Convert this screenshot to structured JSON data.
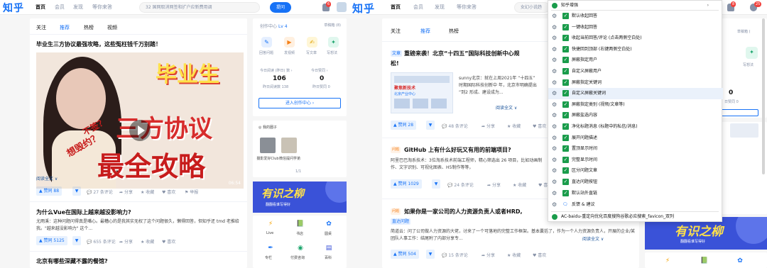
{
  "left": {
    "logo": "知乎",
    "nav": [
      "首页",
      "会员",
      "发现",
      "等你来答"
    ],
    "search_placeholder": "32 国网取消网签和扩户应新费用调",
    "ask_button": "提问",
    "notif_count": "6",
    "tabs": [
      "关注",
      "推荐",
      "热榜",
      "视频"
    ],
    "q1": {
      "title": "毕业生三方协议最强攻略，这些冤枉钱千万别踏！",
      "cover_line1": "毕业生",
      "cover_line2": "三方协议",
      "cover_line3": "最全攻略",
      "cover_tag1": "不签？",
      "cover_tag2": "想毁约？",
      "duration": "06:54",
      "read_more": "阅读全文 ∨",
      "vote": "▲ 赞同 88",
      "comments": "27 条评论",
      "share": "分享",
      "fav": "收藏",
      "like": "喜欢",
      "report": "举报"
    },
    "q2": {
      "title": "为什么Vue在国际上越来越没影响力?",
      "excerpt": "尤雨溪：这种问题问得真是嘴心。最糟心的是我其实无权了这个问题很久，懒得回答，但知乎还 tmd 老推给我。\"越来越没影响力\" 这个...",
      "read_more": "阅读全文 ∨",
      "vote": "▲ 赞同 5125",
      "comments": "655 条评论",
      "share": "分享",
      "fav": "收藏",
      "like": "喜欢"
    },
    "q3": {
      "title": "北京有哪些深藏不露的餐馆?"
    },
    "side": {
      "creator": "创作中心",
      "level": "Lv 4",
      "drafts": "草稿箱 (8)",
      "tools": [
        {
          "label": "回答问题",
          "icon": "answer-icon"
        },
        {
          "label": "发视频",
          "icon": "video-icon"
        },
        {
          "label": "写文章",
          "icon": "article-icon"
        },
        {
          "label": "写想法",
          "icon": "idea-icon"
        }
      ],
      "stat1_label": "今日阅读 (昨日) 数 ›",
      "stat1_value": "106",
      "stat1_sub": "昨日阅读数 138",
      "stat2_label": "今日赞同 ›",
      "stat2_value": "0",
      "stat2_sub": "昨日赞同 0",
      "enter_creator": "进入创作中心 ›",
      "my_circles": "我的圈子",
      "circles": [
        {
          "name": "摄影爱好Club"
        },
        {
          "name": "微信提问学弟"
        }
      ],
      "pager": "1/1",
      "banner_title": "有识之柳",
      "banner_sub": "翻翻看谁写得好",
      "quick": [
        {
          "label": "Live",
          "icon": "live-icon"
        },
        {
          "label": "书店",
          "icon": "book-icon"
        },
        {
          "label": "圆桌",
          "icon": "roundtable-icon"
        },
        {
          "label": "专栏",
          "icon": "column-icon"
        },
        {
          "label": "付费咨询",
          "icon": "consult-icon"
        },
        {
          "label": "百科",
          "icon": "wiki-icon"
        }
      ]
    }
  },
  "right": {
    "logo": "知乎",
    "nav": [
      "首页",
      "会员",
      "发现",
      "等你来答"
    ],
    "search_placeholder": "女幻小说趋",
    "notif_count": "8",
    "msg_count": "25",
    "tabs": [
      "关注",
      "推荐",
      "热榜"
    ],
    "q1": {
      "tag": "文章",
      "title": "重磅来袭！北京“十四五”国际科技创新中心规",
      "title2": "松!",
      "thumb_line1": "聚焦新技术",
      "thumb_line2": "北京产业中心",
      "excerpt": "sunny北京：就在上周2021年 “十四五” 时期国际科技创新中 年，北京市明确提出 “到2 形成、建设成为...",
      "read_more": "阅读全文 ∨",
      "vote": "▲ 赞同 28",
      "comments": "48 条评论",
      "share": "分享",
      "fav": "收藏",
      "like": "喜欢"
    },
    "q2": {
      "tag": "问题",
      "title": "GitHub 上有什么好玩又有用的前端项目?",
      "excerpt": "阿里巴巴淘系技术：3位淘系技术前端工程师，精心筛选出 26 项目，比如动画制作、文字识别、可视化图表、H5制作等等，",
      "vote": "▲ 赞同 1029",
      "comments": "24 条评论",
      "share": "分享",
      "fav": "收藏",
      "like": "喜欢"
    },
    "q3": {
      "tag": "问题",
      "title": "如果你是一家公司的人力资源负责人或者HRD,",
      "answer_tag": "直达问题",
      "excerpt": "简道云：问了公司做人力资源的大佬，讨来了一个可落地的完整工作框架。基本囊括了，作为一个人力资源负责人，开展的企业/某团队人事工作：结尾附了内部分享专...",
      "read_more": "阅读全文 ∨",
      "vote": "▲ 赞同 504",
      "comments": "15 条评论",
      "share": "分享",
      "fav": "收藏",
      "like": "喜欢"
    },
    "side": {
      "drafts": "草稿箱 (",
      "idea": "写想法",
      "stat_value": "0",
      "stat_sub": "日赞同 0"
    },
    "menu": {
      "header": "知乎增强",
      "items": [
        {
          "label": "默认收起回答",
          "checked": true
        },
        {
          "label": "一键收起回答",
          "checked": true
        },
        {
          "label": "收起当前回答/评论 (点击两侧空白处)",
          "checked": true
        },
        {
          "label": "快捷回到顶部 (右键两侧空白处)",
          "checked": true
        },
        {
          "label": "屏蔽指定用户",
          "checked": true
        },
        {
          "label": "自定义屏蔽用户",
          "checked": true
        },
        {
          "label": "屏蔽指定关键词",
          "checked": true
        },
        {
          "label": "自定义屏蔽关键词",
          "checked": true
        },
        {
          "label": "屏蔽指定类别 (视频/文章等)",
          "checked": true
        },
        {
          "label": "屏蔽盐选内容",
          "checked": true
        },
        {
          "label": "净化标题消息 (标题中的私信/消息)",
          "checked": true
        },
        {
          "label": "展开问题描述",
          "checked": true
        },
        {
          "label": "置顶显示时间",
          "checked": true
        },
        {
          "label": "完整显示时间",
          "checked": true
        },
        {
          "label": "区分问题文章",
          "checked": true
        },
        {
          "label": "直达问题按钮",
          "checked": true
        },
        {
          "label": "默认站外直链",
          "checked": true
        }
      ],
      "feedback": "反馈 & 建议",
      "footer": "AC-baidu-重定向优化百度搜狗谷歌必应搜索_favicon_双列"
    }
  },
  "colors": {
    "brand": "#1772f6",
    "checkbox": "#1a9c4b",
    "badge": "#f1403c"
  }
}
